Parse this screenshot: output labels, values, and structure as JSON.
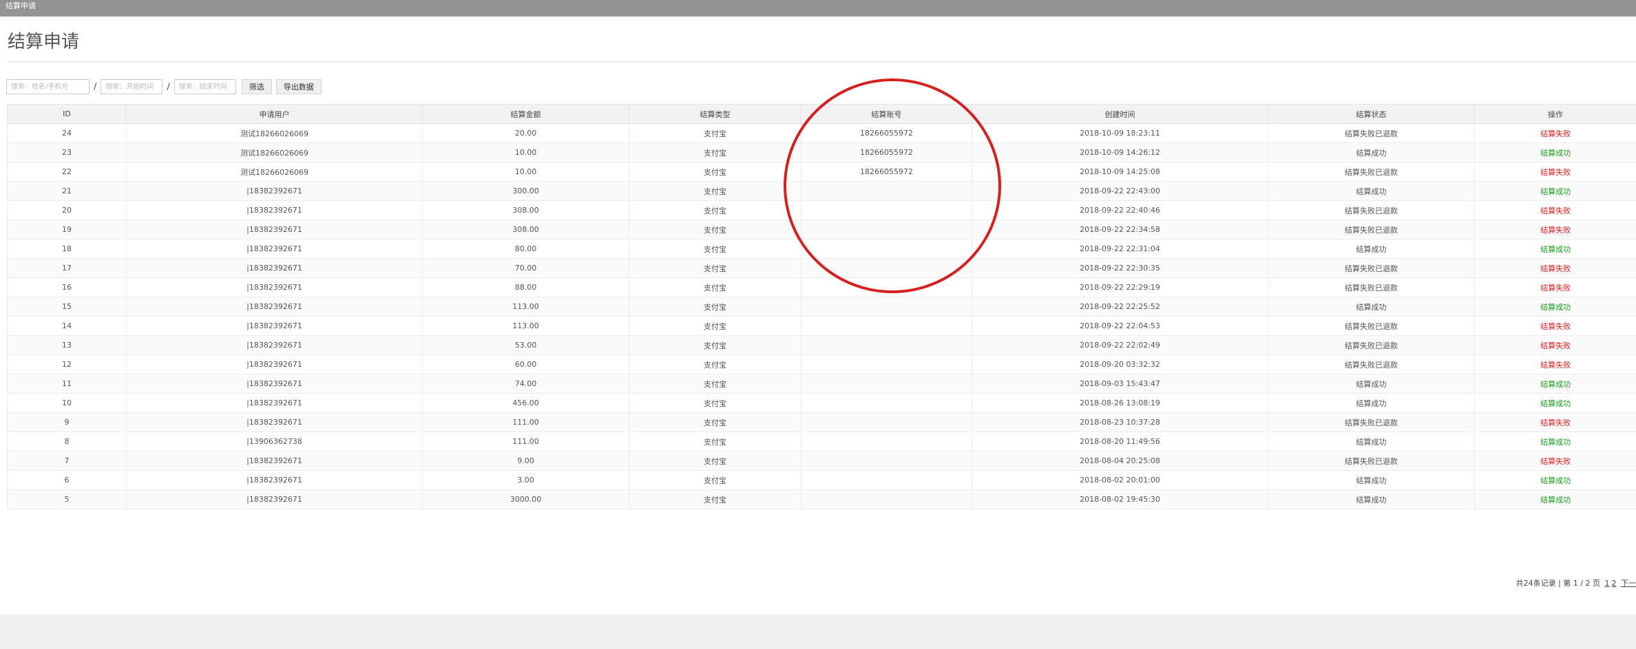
{
  "window": {
    "title": "结算申请"
  },
  "page": {
    "title": "结算申请"
  },
  "filters": {
    "name_placeholder": "搜索：姓名/手机号",
    "separator": "/",
    "start_placeholder": "搜索：开始时间",
    "end_placeholder": "搜索：结束时间",
    "filter_label": "筛选",
    "export_label": "导出数据"
  },
  "table": {
    "headers": [
      "ID",
      "申请用户",
      "结算金额",
      "结算类型",
      "结算账号",
      "创建时间",
      "结算状态",
      "操作"
    ],
    "rows": [
      {
        "id": "24",
        "user": "测试18266026069",
        "amount": "20.00",
        "type": "支付宝",
        "account": "18266055972",
        "time": "2018-10-09 18:23:11",
        "status": "结算失败已退款",
        "op": "结算失败"
      },
      {
        "id": "23",
        "user": "测试18266026069",
        "amount": "10.00",
        "type": "支付宝",
        "account": "18266055972",
        "time": "2018-10-09 14:26:12",
        "status": "结算成功",
        "op": "结算成功"
      },
      {
        "id": "22",
        "user": "测试18266026069",
        "amount": "10.00",
        "type": "支付宝",
        "account": "18266055972",
        "time": "2018-10-09 14:25:08",
        "status": "结算失败已退款",
        "op": "结算失败"
      },
      {
        "id": "21",
        "user": "|18382392671",
        "amount": "300.00",
        "type": "支付宝",
        "account": "",
        "time": "2018-09-22 22:43:00",
        "status": "结算成功",
        "op": "结算成功"
      },
      {
        "id": "20",
        "user": "|18382392671",
        "amount": "308.00",
        "type": "支付宝",
        "account": "",
        "time": "2018-09-22 22:40:46",
        "status": "结算失败已退款",
        "op": "结算失败"
      },
      {
        "id": "19",
        "user": "|18382392671",
        "amount": "308.00",
        "type": "支付宝",
        "account": "",
        "time": "2018-09-22 22:34:58",
        "status": "结算失败已退款",
        "op": "结算失败"
      },
      {
        "id": "18",
        "user": "|18382392671",
        "amount": "80.00",
        "type": "支付宝",
        "account": "",
        "time": "2018-09-22 22:31:04",
        "status": "结算成功",
        "op": "结算成功"
      },
      {
        "id": "17",
        "user": "|18382392671",
        "amount": "70.00",
        "type": "支付宝",
        "account": "",
        "time": "2018-09-22 22:30:35",
        "status": "结算失败已退款",
        "op": "结算失败"
      },
      {
        "id": "16",
        "user": "|18382392671",
        "amount": "88.00",
        "type": "支付宝",
        "account": "",
        "time": "2018-09-22 22:29:19",
        "status": "结算失败已退款",
        "op": "结算失败"
      },
      {
        "id": "15",
        "user": "|18382392671",
        "amount": "113.00",
        "type": "支付宝",
        "account": "",
        "time": "2018-09-22 22:25:52",
        "status": "结算成功",
        "op": "结算成功"
      },
      {
        "id": "14",
        "user": "|18382392671",
        "amount": "113.00",
        "type": "支付宝",
        "account": "",
        "time": "2018-09-22 22:04:53",
        "status": "结算失败已退款",
        "op": "结算失败"
      },
      {
        "id": "13",
        "user": "|18382392671",
        "amount": "53.00",
        "type": "支付宝",
        "account": "",
        "time": "2018-09-22 22:02:49",
        "status": "结算失败已退款",
        "op": "结算失败"
      },
      {
        "id": "12",
        "user": "|18382392671",
        "amount": "60.00",
        "type": "支付宝",
        "account": "",
        "time": "2018-09-20 03:32:32",
        "status": "结算失败已退款",
        "op": "结算失败"
      },
      {
        "id": "11",
        "user": "|18382392671",
        "amount": "74.00",
        "type": "支付宝",
        "account": "",
        "time": "2018-09-03 15:43:47",
        "status": "结算成功",
        "op": "结算成功"
      },
      {
        "id": "10",
        "user": "|18382392671",
        "amount": "456.00",
        "type": "支付宝",
        "account": "",
        "time": "2018-08-26 13:08:19",
        "status": "结算成功",
        "op": "结算成功"
      },
      {
        "id": "9",
        "user": "|18382392671",
        "amount": "111.00",
        "type": "支付宝",
        "account": "",
        "time": "2018-08-23 10:37:28",
        "status": "结算失败已退款",
        "op": "结算失败"
      },
      {
        "id": "8",
        "user": "|13906362738",
        "amount": "111.00",
        "type": "支付宝",
        "account": "",
        "time": "2018-08-20 11:49:56",
        "status": "结算成功",
        "op": "结算成功"
      },
      {
        "id": "7",
        "user": "|18382392671",
        "amount": "9.00",
        "type": "支付宝",
        "account": "",
        "time": "2018-08-04 20:25:08",
        "status": "结算失败已退款",
        "op": "结算失败"
      },
      {
        "id": "6",
        "user": "|18382392671",
        "amount": "3.00",
        "type": "支付宝",
        "account": "",
        "time": "2018-08-02 20:01:00",
        "status": "结算成功",
        "op": "结算成功"
      },
      {
        "id": "5",
        "user": "|18382392671",
        "amount": "3000.00",
        "type": "支付宝",
        "account": "",
        "time": "2018-08-02 19:45:30",
        "status": "结算成功",
        "op": "结算成功"
      }
    ]
  },
  "pagination": {
    "summary": "共24条记录 | 第 1 / 2 页",
    "page1": "1",
    "page2": "2",
    "next": "下一"
  },
  "colors": {
    "success": "#1a9e1a",
    "fail": "#e21b1b",
    "highlight": "#d62020"
  }
}
